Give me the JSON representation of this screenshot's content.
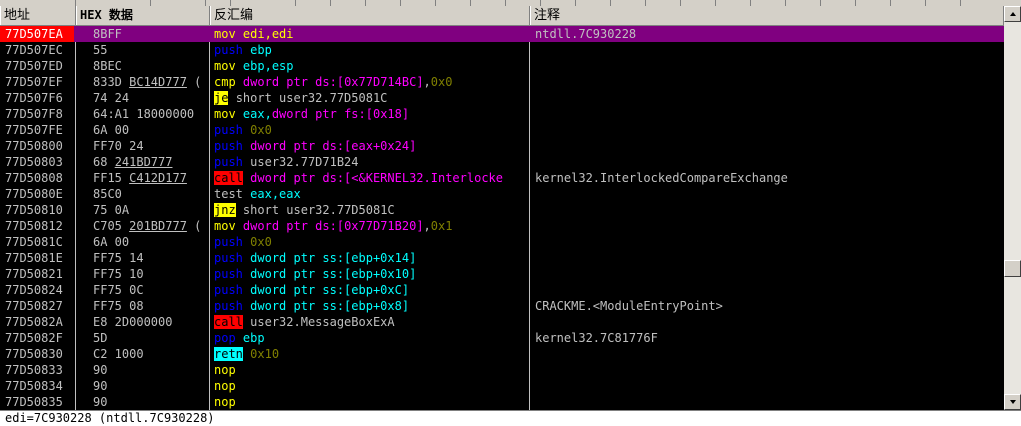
{
  "columns": {
    "address": "地址",
    "hex": "HEX 数据",
    "disasm": "反汇编",
    "comment": "注释"
  },
  "rows": [
    {
      "addr": "77D507EA",
      "hex": "8BFF",
      "cur": true,
      "sel": true,
      "dis": [
        [
          "mov",
          "mn-y"
        ],
        [
          " ",
          ""
        ],
        [
          "edi,edi",
          "op-y"
        ]
      ],
      "cmt": "ntdll.7C930228"
    },
    {
      "addr": "77D507EC",
      "hex": "55",
      "dis": [
        [
          "push",
          "mn-b"
        ],
        [
          " ",
          ""
        ],
        [
          "ebp",
          "op-c2"
        ]
      ],
      "cmt": ""
    },
    {
      "addr": "77D507ED",
      "hex": "8BEC",
      "dis": [
        [
          "mov",
          "mn-y"
        ],
        [
          " ",
          ""
        ],
        [
          "ebp,esp",
          "op-c2"
        ]
      ],
      "cmt": ""
    },
    {
      "addr": "77D507EF",
      "hex": "833D BC14D777 (",
      "hexu": "BC14D777",
      "dis": [
        [
          "cmp",
          "mn-y"
        ],
        [
          " ",
          ""
        ],
        [
          "dword ptr ds:[0x77D714BC]",
          "op-m"
        ],
        [
          ",",
          "op-w"
        ],
        [
          "0x0",
          "op-c"
        ]
      ],
      "cmt": ""
    },
    {
      "addr": "77D507F6",
      "hex": "74 24",
      "dis": [
        [
          "je",
          "mn-jmp"
        ],
        [
          " ",
          ""
        ],
        [
          "short user32.77D5081C",
          "op-w"
        ]
      ],
      "cmt": ""
    },
    {
      "addr": "77D507F8",
      "hex": "64:A1 18000000",
      "dis": [
        [
          "mov",
          "mn-y"
        ],
        [
          " ",
          ""
        ],
        [
          "eax,",
          "op-c2"
        ],
        [
          "dword ptr fs:[0x18]",
          "op-m"
        ]
      ],
      "cmt": ""
    },
    {
      "addr": "77D507FE",
      "hex": "6A 00",
      "dis": [
        [
          "push",
          "mn-b"
        ],
        [
          " ",
          ""
        ],
        [
          "0x0",
          "op-c"
        ]
      ],
      "cmt": ""
    },
    {
      "addr": "77D50800",
      "hex": "FF70 24",
      "dis": [
        [
          "push",
          "mn-b"
        ],
        [
          " ",
          ""
        ],
        [
          "dword ptr ds:[eax+0x24]",
          "op-m"
        ]
      ],
      "cmt": ""
    },
    {
      "addr": "77D50803",
      "hex": "68 241BD777",
      "hexu": "241BD777",
      "dis": [
        [
          "push",
          "mn-b"
        ],
        [
          " ",
          ""
        ],
        [
          "user32.77D71B24",
          "op-w"
        ]
      ],
      "cmt": ""
    },
    {
      "addr": "77D50808",
      "hex": "FF15 C412D177",
      "hexu": "C412D177",
      "dis": [
        [
          "call",
          "mn-call"
        ],
        [
          " ",
          ""
        ],
        [
          "dword ptr ds:[<&KERNEL32.Interlocke",
          "op-m"
        ]
      ],
      "cmt": "kernel32.InterlockedCompareExchange"
    },
    {
      "addr": "77D5080E",
      "hex": "85C0",
      "dis": [
        [
          "test",
          "mn-w"
        ],
        [
          " ",
          ""
        ],
        [
          "eax,eax",
          "op-c2"
        ]
      ],
      "cmt": ""
    },
    {
      "addr": "77D50810",
      "hex": "75 0A",
      "dis": [
        [
          "jnz",
          "mn-jmp"
        ],
        [
          " ",
          ""
        ],
        [
          "short user32.77D5081C",
          "op-w"
        ]
      ],
      "cmt": ""
    },
    {
      "addr": "77D50812",
      "hex": "C705 201BD777 (",
      "hexu": "201BD777",
      "dis": [
        [
          "mov",
          "mn-y"
        ],
        [
          " ",
          ""
        ],
        [
          "dword ptr ds:[0x77D71B20]",
          "op-m"
        ],
        [
          ",",
          "op-w"
        ],
        [
          "0x1",
          "op-c"
        ]
      ],
      "cmt": ""
    },
    {
      "addr": "77D5081C",
      "hex": "6A 00",
      "dis": [
        [
          "push",
          "mn-b"
        ],
        [
          " ",
          ""
        ],
        [
          "0x0",
          "op-c"
        ]
      ],
      "cmt": ""
    },
    {
      "addr": "77D5081E",
      "hex": "FF75 14",
      "dis": [
        [
          "push",
          "mn-b"
        ],
        [
          " ",
          ""
        ],
        [
          "dword ptr ss:[ebp+0x14]",
          "op-c2"
        ]
      ],
      "cmt": ""
    },
    {
      "addr": "77D50821",
      "hex": "FF75 10",
      "dis": [
        [
          "push",
          "mn-b"
        ],
        [
          " ",
          ""
        ],
        [
          "dword ptr ss:[ebp+0x10]",
          "op-c2"
        ]
      ],
      "cmt": ""
    },
    {
      "addr": "77D50824",
      "hex": "FF75 0C",
      "dis": [
        [
          "push",
          "mn-b"
        ],
        [
          " ",
          ""
        ],
        [
          "dword ptr ss:[ebp+0xC]",
          "op-c2"
        ]
      ],
      "cmt": ""
    },
    {
      "addr": "77D50827",
      "hex": "FF75 08",
      "dis": [
        [
          "push",
          "mn-b"
        ],
        [
          " ",
          ""
        ],
        [
          "dword ptr ss:[ebp+0x8]",
          "op-c2"
        ]
      ],
      "cmt": "CRACKME.<ModuleEntryPoint>"
    },
    {
      "addr": "77D5082A",
      "hex": "E8 2D000000",
      "dis": [
        [
          "call",
          "mn-call"
        ],
        [
          " ",
          ""
        ],
        [
          "user32.MessageBoxExA",
          "op-w"
        ]
      ],
      "cmt": ""
    },
    {
      "addr": "77D5082F",
      "hex": "5D",
      "dis": [
        [
          "pop",
          "mn-b"
        ],
        [
          " ",
          ""
        ],
        [
          "ebp",
          "op-c2"
        ]
      ],
      "cmt": "kernel32.7C81776F"
    },
    {
      "addr": "77D50830",
      "hex": "C2 1000",
      "dis": [
        [
          "retn",
          "mn-ret"
        ],
        [
          " ",
          ""
        ],
        [
          "0x10",
          "op-c"
        ]
      ],
      "cmt": ""
    },
    {
      "addr": "77D50833",
      "hex": "90",
      "dis": [
        [
          "nop",
          "mn-y"
        ]
      ],
      "cmt": ""
    },
    {
      "addr": "77D50834",
      "hex": "90",
      "dis": [
        [
          "nop",
          "mn-y"
        ]
      ],
      "cmt": ""
    },
    {
      "addr": "77D50835",
      "hex": "90",
      "dis": [
        [
          "nop",
          "mn-y"
        ]
      ],
      "cmt": ""
    }
  ],
  "status": "edi=7C930228 (ntdll.7C930228)",
  "colors": {
    "selected_row": "#800080",
    "current_eip": "#ff0000",
    "background": "#000000",
    "jump_highlight": "#ffff00",
    "call_highlight": "#ff0000",
    "ret_highlight": "#00ffff"
  }
}
